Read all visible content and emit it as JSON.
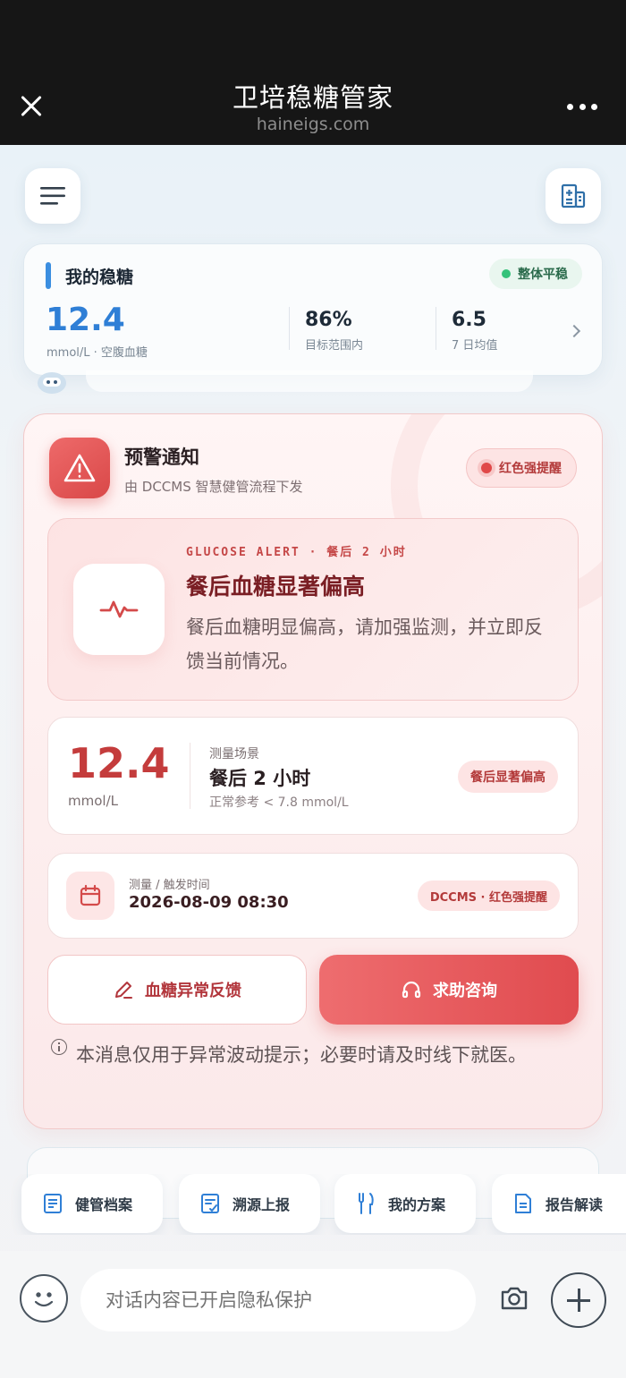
{
  "window": {
    "title": "卫培稳糖管家",
    "domain": "haineigs.com"
  },
  "summary": {
    "title": "我的稳糖",
    "status": "整体平稳",
    "glucose": {
      "value": "12.4",
      "label": "mmol/L · 空腹血糖"
    },
    "in_range": {
      "value": "86%",
      "label": "目标范围内"
    },
    "avg": {
      "value": "6.5",
      "label": "7 日均值"
    }
  },
  "alert": {
    "title": "预警通知",
    "subtitle": "由 DCCMS 智慧健管流程下发",
    "badge": "红色强提醒",
    "tag": "GLUCOSE ALERT · 餐后 2 小时",
    "heading": "餐后血糖显著偏高",
    "description": "餐后血糖明显偏高，请加强监测，并立即反馈当前情况。",
    "measurement": {
      "value": "12.4",
      "unit": "mmol/L",
      "scene_label": "测量场景",
      "scene": "餐后 2 小时",
      "reference": "正常参考 < 7.8 mmol/L",
      "level": "餐后显著偏高"
    },
    "time": {
      "label": "测量 / 触发时间",
      "value": "2026-08-09 08:30",
      "source": "DCCMS · 红色强提醒"
    },
    "feedback_button": "血糖异常反馈",
    "help_button": "求助咨询",
    "note": "本消息仅用于异常波动提示；必要时请及时线下就医。"
  },
  "quick_actions": [
    "健管档案",
    "溯源上报",
    "我的方案",
    "报告解读"
  ],
  "input": {
    "placeholder": "对话内容已开启隐私保护"
  },
  "colors": {
    "accent_blue": "#2f7fd6",
    "alert_red": "#e04848",
    "ok_green": "#35c27a"
  }
}
